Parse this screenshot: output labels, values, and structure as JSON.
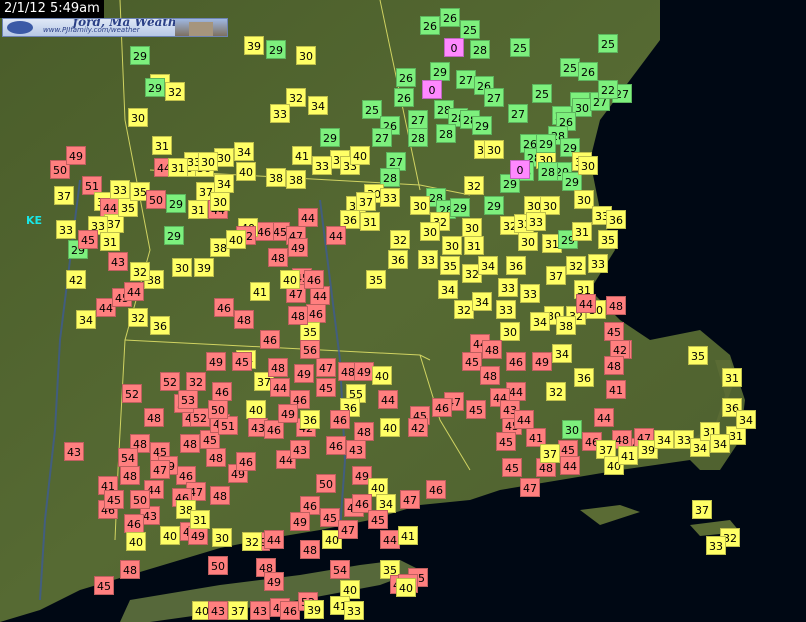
{
  "header": {
    "timestamp": "2/1/12 5:49am"
  },
  "logo": {
    "title": "ford, Ma Weather",
    "subtitle": "www.PJIfamily.com/weather",
    "colors": {
      "bg": "#c9d6ee",
      "text": "#2a3f86"
    }
  },
  "legend_colors": {
    "cold": "#7df07d",
    "cool": "#ffff66",
    "mild": "#ffcc66",
    "warm": "#ff7f7f",
    "freezing": "#ff88ff"
  },
  "map_labels": [
    {
      "text": "KE",
      "color": "#19e6e6"
    }
  ],
  "stations": [
    {
      "t": "26",
      "c": "g"
    },
    {
      "t": "26",
      "c": "g"
    },
    {
      "t": "25",
      "c": "g"
    },
    {
      "t": "0",
      "c": "p"
    },
    {
      "t": "28",
      "c": "g"
    },
    {
      "t": "25",
      "c": "g"
    },
    {
      "t": "25",
      "c": "g"
    },
    {
      "t": "26",
      "c": "g"
    },
    {
      "t": "25",
      "c": "g"
    },
    {
      "t": "26",
      "c": "g"
    },
    {
      "t": "27",
      "c": "g"
    },
    {
      "t": "29",
      "c": "g"
    },
    {
      "t": "27",
      "c": "g"
    },
    {
      "t": "26",
      "c": "g"
    },
    {
      "t": "26",
      "c": "g"
    },
    {
      "t": "0",
      "c": "p"
    },
    {
      "t": "27",
      "c": "g"
    },
    {
      "t": "26",
      "c": "g"
    },
    {
      "t": "28",
      "c": "g"
    },
    {
      "t": "30",
      "c": "g"
    },
    {
      "t": "27",
      "c": "g"
    },
    {
      "t": "25",
      "c": "g"
    },
    {
      "t": "22",
      "c": "g"
    },
    {
      "t": "27",
      "c": "g"
    },
    {
      "t": "25",
      "c": "g"
    },
    {
      "t": "26",
      "c": "g"
    },
    {
      "t": "28",
      "c": "g"
    },
    {
      "t": "28",
      "c": "g"
    },
    {
      "t": "27",
      "c": "g"
    },
    {
      "t": "26",
      "c": "g"
    },
    {
      "t": "27",
      "c": "g"
    },
    {
      "t": "28",
      "c": "g"
    },
    {
      "t": "26",
      "c": "g"
    },
    {
      "t": "28",
      "c": "g"
    },
    {
      "t": "29",
      "c": "g"
    },
    {
      "t": "30",
      "c": "y"
    },
    {
      "t": "27",
      "c": "g"
    },
    {
      "t": "28",
      "c": "g"
    },
    {
      "t": "30",
      "c": "y"
    },
    {
      "t": "28",
      "c": "g"
    },
    {
      "t": "30",
      "c": "y"
    },
    {
      "t": "29",
      "c": "g"
    },
    {
      "t": "30",
      "c": "y"
    },
    {
      "t": "28",
      "c": "g"
    },
    {
      "t": "29",
      "c": "g"
    },
    {
      "t": "0",
      "c": "p"
    },
    {
      "t": "28",
      "c": "g"
    },
    {
      "t": "29",
      "c": "g"
    },
    {
      "t": "30",
      "c": "y"
    },
    {
      "t": "29",
      "c": "g"
    },
    {
      "t": "30",
      "c": "y"
    },
    {
      "t": "28",
      "c": "g"
    },
    {
      "t": "28",
      "c": "g"
    },
    {
      "t": "29",
      "c": "g"
    },
    {
      "t": "29",
      "c": "g"
    },
    {
      "t": "30",
      "c": "y"
    },
    {
      "t": "28",
      "c": "g"
    },
    {
      "t": "28",
      "c": "g"
    },
    {
      "t": "29",
      "c": "g"
    },
    {
      "t": "30",
      "c": "y"
    },
    {
      "t": "29",
      "c": "g"
    },
    {
      "t": "30",
      "c": "y"
    },
    {
      "t": "30",
      "c": "y"
    },
    {
      "t": "32",
      "c": "y"
    },
    {
      "t": "30",
      "c": "y"
    },
    {
      "t": "32",
      "c": "y"
    },
    {
      "t": "33",
      "c": "y"
    },
    {
      "t": "30",
      "c": "y"
    },
    {
      "t": "32",
      "c": "y"
    },
    {
      "t": "31",
      "c": "y"
    },
    {
      "t": "32",
      "c": "y"
    },
    {
      "t": "30",
      "c": "y"
    },
    {
      "t": "30",
      "c": "y"
    },
    {
      "t": "31",
      "c": "y"
    },
    {
      "t": "32",
      "c": "y"
    },
    {
      "t": "33",
      "c": "y"
    },
    {
      "t": "33",
      "c": "y"
    },
    {
      "t": "30",
      "c": "y"
    },
    {
      "t": "31",
      "c": "y"
    },
    {
      "t": "29",
      "c": "g"
    },
    {
      "t": "31",
      "c": "y"
    },
    {
      "t": "33",
      "c": "y"
    },
    {
      "t": "35",
      "c": "y"
    },
    {
      "t": "36",
      "c": "y"
    },
    {
      "t": "35",
      "c": "y"
    },
    {
      "t": "36",
      "c": "y"
    },
    {
      "t": "33",
      "c": "y"
    },
    {
      "t": "35",
      "c": "y"
    },
    {
      "t": "32",
      "c": "y"
    },
    {
      "t": "34",
      "c": "y"
    },
    {
      "t": "36",
      "c": "y"
    },
    {
      "t": "33",
      "c": "y"
    },
    {
      "t": "37",
      "c": "y"
    },
    {
      "t": "32",
      "c": "y"
    },
    {
      "t": "31",
      "c": "y"
    },
    {
      "t": "30",
      "c": "y"
    },
    {
      "t": "32",
      "c": "y"
    },
    {
      "t": "30",
      "c": "y"
    },
    {
      "t": "33",
      "c": "y"
    },
    {
      "t": "33",
      "c": "y"
    },
    {
      "t": "34",
      "c": "y"
    },
    {
      "t": "32",
      "c": "y"
    },
    {
      "t": "34",
      "c": "y"
    },
    {
      "t": "33",
      "c": "y"
    },
    {
      "t": "30",
      "c": "y"
    },
    {
      "t": "34",
      "c": "y"
    },
    {
      "t": "38",
      "c": "y"
    },
    {
      "t": "44",
      "c": "r"
    },
    {
      "t": "45",
      "c": "r"
    },
    {
      "t": "42",
      "c": "r"
    },
    {
      "t": "41",
      "c": "r"
    },
    {
      "t": "36",
      "c": "y"
    },
    {
      "t": "32",
      "c": "y"
    },
    {
      "t": "44",
      "c": "r"
    },
    {
      "t": "44",
      "c": "r"
    },
    {
      "t": "45",
      "c": "r"
    },
    {
      "t": "48",
      "c": "r"
    },
    {
      "t": "44",
      "c": "r"
    },
    {
      "t": "45",
      "c": "r"
    },
    {
      "t": "45",
      "c": "r"
    },
    {
      "t": "43",
      "c": "r"
    },
    {
      "t": "47",
      "c": "r"
    },
    {
      "t": "48",
      "c": "r"
    },
    {
      "t": "46",
      "c": "r"
    },
    {
      "t": "49",
      "c": "r"
    },
    {
      "t": "34",
      "c": "y"
    },
    {
      "t": "44",
      "c": "r"
    },
    {
      "t": "42",
      "c": "r"
    },
    {
      "t": "48",
      "c": "r"
    },
    {
      "t": "48",
      "c": "r"
    },
    {
      "t": "44",
      "c": "r"
    },
    {
      "t": "48",
      "c": "r"
    },
    {
      "t": "47",
      "c": "r"
    },
    {
      "t": "46",
      "c": "r"
    },
    {
      "t": "45",
      "c": "r"
    },
    {
      "t": "44",
      "c": "r"
    },
    {
      "t": "48",
      "c": "r"
    },
    {
      "t": "47",
      "c": "r"
    },
    {
      "t": "45",
      "c": "r"
    },
    {
      "t": "45",
      "c": "r"
    },
    {
      "t": "44",
      "c": "r"
    },
    {
      "t": "41",
      "c": "r"
    },
    {
      "t": "37",
      "c": "y"
    },
    {
      "t": "30",
      "c": "g"
    },
    {
      "t": "37",
      "c": "y"
    },
    {
      "t": "40",
      "c": "y"
    },
    {
      "t": "41",
      "c": "y"
    },
    {
      "t": "39",
      "c": "y"
    },
    {
      "t": "34",
      "c": "y"
    },
    {
      "t": "33",
      "c": "y"
    },
    {
      "t": "34",
      "c": "y"
    },
    {
      "t": "31",
      "c": "y"
    },
    {
      "t": "31",
      "c": "y"
    },
    {
      "t": "34",
      "c": "y"
    },
    {
      "t": "36",
      "c": "y"
    },
    {
      "t": "34",
      "c": "y"
    },
    {
      "t": "31",
      "c": "y"
    },
    {
      "t": "35",
      "c": "y"
    },
    {
      "t": "32",
      "c": "y"
    },
    {
      "t": "33",
      "c": "y"
    },
    {
      "t": "37",
      "c": "y"
    },
    {
      "t": "39",
      "c": "y"
    },
    {
      "t": "29",
      "c": "g"
    },
    {
      "t": "30",
      "c": "y"
    },
    {
      "t": "32",
      "c": "y"
    },
    {
      "t": "34",
      "c": "y"
    },
    {
      "t": "33",
      "c": "y"
    },
    {
      "t": "34",
      "c": "y"
    },
    {
      "t": "30",
      "c": "y"
    },
    {
      "t": "36",
      "c": "y"
    },
    {
      "t": "40",
      "c": "y"
    },
    {
      "t": "38",
      "c": "y"
    },
    {
      "t": "38",
      "c": "y"
    },
    {
      "t": "41",
      "c": "y"
    },
    {
      "t": "33",
      "c": "y"
    },
    {
      "t": "33",
      "c": "y"
    },
    {
      "t": "40",
      "c": "y"
    },
    {
      "t": "37",
      "c": "y"
    },
    {
      "t": "36",
      "c": "y"
    },
    {
      "t": "44",
      "c": "r"
    },
    {
      "t": "45",
      "c": "r"
    },
    {
      "t": "47",
      "c": "r"
    },
    {
      "t": "46",
      "c": "r"
    },
    {
      "t": "49",
      "c": "r"
    },
    {
      "t": "48",
      "c": "r"
    },
    {
      "t": "45",
      "c": "r"
    },
    {
      "t": "47",
      "c": "r"
    },
    {
      "t": "44",
      "c": "r"
    },
    {
      "t": "46",
      "c": "r"
    },
    {
      "t": "44",
      "c": "r"
    },
    {
      "t": "40",
      "c": "y"
    },
    {
      "t": "46",
      "c": "r"
    },
    {
      "t": "40",
      "c": "y"
    },
    {
      "t": "39",
      "c": "y"
    },
    {
      "t": "38",
      "c": "y"
    },
    {
      "t": "42",
      "c": "r"
    },
    {
      "t": "37",
      "c": "y"
    },
    {
      "t": "44",
      "c": "r"
    },
    {
      "t": "40",
      "c": "y"
    },
    {
      "t": "41",
      "c": "y"
    },
    {
      "t": "46",
      "c": "r"
    },
    {
      "t": "48",
      "c": "r"
    },
    {
      "t": "35",
      "c": "y"
    },
    {
      "t": "34",
      "c": "y"
    },
    {
      "t": "37",
      "c": "y"
    },
    {
      "t": "44",
      "c": "r"
    },
    {
      "t": "40",
      "c": "y"
    },
    {
      "t": "43",
      "c": "r"
    },
    {
      "t": "45",
      "c": "r"
    },
    {
      "t": "48",
      "c": "r"
    },
    {
      "t": "46",
      "c": "r"
    },
    {
      "t": "47",
      "c": "r"
    },
    {
      "t": "48",
      "c": "r"
    },
    {
      "t": "49",
      "c": "r"
    },
    {
      "t": "46",
      "c": "r"
    },
    {
      "t": "44",
      "c": "r"
    },
    {
      "t": "42",
      "c": "r"
    },
    {
      "t": "43",
      "c": "r"
    },
    {
      "t": "46",
      "c": "r"
    },
    {
      "t": "45",
      "c": "r"
    },
    {
      "t": "48",
      "c": "r"
    },
    {
      "t": "49",
      "c": "r"
    },
    {
      "t": "55",
      "c": "y"
    },
    {
      "t": "36",
      "c": "y"
    },
    {
      "t": "40",
      "c": "y"
    },
    {
      "t": "44",
      "c": "r"
    },
    {
      "t": "47",
      "c": "r"
    },
    {
      "t": "56",
      "c": "r"
    },
    {
      "t": "48",
      "c": "r"
    },
    {
      "t": "46",
      "c": "r"
    },
    {
      "t": "45",
      "c": "r"
    },
    {
      "t": "49",
      "c": "r"
    },
    {
      "t": "46",
      "c": "r"
    },
    {
      "t": "46",
      "c": "r"
    },
    {
      "t": "47",
      "c": "r"
    },
    {
      "t": "48",
      "c": "r"
    },
    {
      "t": "48",
      "c": "r"
    },
    {
      "t": "49",
      "c": "r"
    },
    {
      "t": "49",
      "c": "r"
    },
    {
      "t": "46",
      "c": "r"
    },
    {
      "t": "43",
      "c": "r"
    },
    {
      "t": "49",
      "c": "r"
    },
    {
      "t": "40",
      "c": "y"
    },
    {
      "t": "34",
      "c": "y"
    },
    {
      "t": "47",
      "c": "r"
    },
    {
      "t": "46",
      "c": "r"
    },
    {
      "t": "45",
      "c": "r"
    },
    {
      "t": "46",
      "c": "r"
    },
    {
      "t": "42",
      "c": "r"
    },
    {
      "t": "40",
      "c": "y"
    },
    {
      "t": "48",
      "c": "r"
    },
    {
      "t": "46",
      "c": "r"
    },
    {
      "t": "36",
      "c": "y"
    },
    {
      "t": "48",
      "c": "r"
    },
    {
      "t": "50",
      "c": "r"
    },
    {
      "t": "46",
      "c": "r"
    },
    {
      "t": "49",
      "c": "r"
    },
    {
      "t": "45",
      "c": "r"
    },
    {
      "t": "40",
      "c": "y"
    },
    {
      "t": "47",
      "c": "r"
    },
    {
      "t": "46",
      "c": "r"
    },
    {
      "t": "45",
      "c": "r"
    },
    {
      "t": "44",
      "c": "r"
    },
    {
      "t": "41",
      "c": "y"
    },
    {
      "t": "35",
      "c": "y"
    },
    {
      "t": "40",
      "c": "y"
    },
    {
      "t": "46",
      "c": "r"
    },
    {
      "t": "48",
      "c": "r"
    },
    {
      "t": "49",
      "c": "r"
    },
    {
      "t": "46",
      "c": "r"
    },
    {
      "t": "51",
      "c": "r"
    },
    {
      "t": "52",
      "c": "r"
    },
    {
      "t": "53",
      "c": "r"
    },
    {
      "t": "52",
      "c": "r"
    },
    {
      "t": "32",
      "c": "r"
    },
    {
      "t": "50",
      "c": "r"
    },
    {
      "t": "53",
      "c": "r"
    },
    {
      "t": "52",
      "c": "r"
    },
    {
      "t": "48",
      "c": "r"
    },
    {
      "t": "48",
      "c": "r"
    },
    {
      "t": "45",
      "c": "r"
    },
    {
      "t": "49",
      "c": "r"
    },
    {
      "t": "46",
      "c": "r"
    },
    {
      "t": "48",
      "c": "r"
    },
    {
      "t": "43",
      "c": "r"
    },
    {
      "t": "46",
      "c": "r"
    },
    {
      "t": "40",
      "c": "y"
    },
    {
      "t": "40",
      "c": "y"
    },
    {
      "t": "38",
      "c": "y"
    },
    {
      "t": "44",
      "c": "r"
    },
    {
      "t": "47",
      "c": "r"
    },
    {
      "t": "50",
      "c": "r"
    },
    {
      "t": "48",
      "c": "r"
    },
    {
      "t": "41",
      "c": "r"
    },
    {
      "t": "43",
      "c": "r"
    },
    {
      "t": "46",
      "c": "r"
    },
    {
      "t": "45",
      "c": "r"
    },
    {
      "t": "54",
      "c": "r"
    },
    {
      "t": "49",
      "c": "r"
    },
    {
      "t": "50",
      "c": "r"
    },
    {
      "t": "48",
      "c": "r"
    },
    {
      "t": "48",
      "c": "r"
    },
    {
      "t": "45",
      "c": "r"
    },
    {
      "t": "40",
      "c": "y"
    },
    {
      "t": "43",
      "c": "r"
    },
    {
      "t": "37",
      "c": "y"
    },
    {
      "t": "43",
      "c": "r"
    },
    {
      "t": "45",
      "c": "r"
    },
    {
      "t": "46",
      "c": "r"
    },
    {
      "t": "52",
      "c": "r"
    },
    {
      "t": "39",
      "c": "y"
    },
    {
      "t": "41",
      "c": "y"
    },
    {
      "t": "33",
      "c": "y"
    },
    {
      "t": "49",
      "c": "r"
    },
    {
      "t": "45",
      "c": "r"
    },
    {
      "t": "42",
      "c": "r"
    },
    {
      "t": "40",
      "c": "y"
    },
    {
      "t": "54",
      "c": "r"
    },
    {
      "t": "44",
      "c": "r"
    },
    {
      "t": "32",
      "c": "y"
    },
    {
      "t": "30",
      "c": "y"
    },
    {
      "t": "31",
      "c": "y"
    },
    {
      "t": "37",
      "c": "y"
    },
    {
      "t": "50",
      "c": "r"
    },
    {
      "t": "49",
      "c": "r"
    },
    {
      "t": "51",
      "c": "r"
    },
    {
      "t": "39",
      "c": "y"
    },
    {
      "t": "44",
      "c": "r"
    },
    {
      "t": "37",
      "c": "y"
    },
    {
      "t": "33",
      "c": "y"
    },
    {
      "t": "35",
      "c": "y"
    },
    {
      "t": "35",
      "c": "y"
    },
    {
      "t": "50",
      "c": "r"
    },
    {
      "t": "44",
      "c": "r"
    },
    {
      "t": "40",
      "c": "y"
    },
    {
      "t": "33",
      "c": "y"
    },
    {
      "t": "29",
      "c": "g"
    },
    {
      "t": "33",
      "c": "y"
    },
    {
      "t": "31",
      "c": "y"
    },
    {
      "t": "33",
      "c": "y"
    },
    {
      "t": "45",
      "c": "r"
    },
    {
      "t": "42",
      "c": "y"
    },
    {
      "t": "43",
      "c": "r"
    },
    {
      "t": "44",
      "c": "r"
    },
    {
      "t": "45",
      "c": "r"
    },
    {
      "t": "44",
      "c": "r"
    },
    {
      "t": "38",
      "c": "y"
    },
    {
      "t": "32",
      "c": "y"
    },
    {
      "t": "36",
      "c": "y"
    },
    {
      "t": "34",
      "c": "y"
    },
    {
      "t": "29",
      "c": "g"
    },
    {
      "t": "31",
      "c": "y"
    },
    {
      "t": "32",
      "c": "y"
    },
    {
      "t": "29",
      "c": "g"
    },
    {
      "t": "30",
      "c": "y"
    },
    {
      "t": "31",
      "c": "y"
    },
    {
      "t": "31",
      "c": "y"
    },
    {
      "t": "30",
      "c": "y"
    },
    {
      "t": "34",
      "c": "y"
    },
    {
      "t": "30",
      "c": "y"
    },
    {
      "t": "29",
      "c": "g"
    },
    {
      "t": "31",
      "c": "y"
    },
    {
      "t": "29",
      "c": "g"
    },
    {
      "t": "32",
      "c": "y"
    },
    {
      "t": "30",
      "c": "y"
    }
  ]
}
